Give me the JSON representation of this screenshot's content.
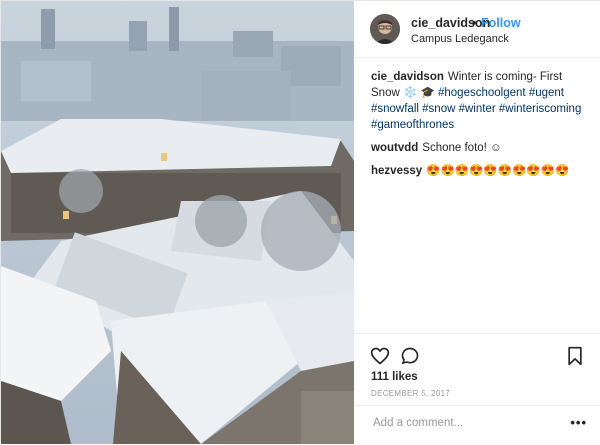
{
  "post": {
    "username": "cie_davidson",
    "separator": "•",
    "follow_label": "Follow",
    "location": "Campus Ledeganck",
    "caption_text": "Winter is coming- First Snow ❄️ 🎓",
    "caption_tags": [
      "#hogeschoolgent",
      "#ugent",
      "#snowfall",
      "#snow",
      "#winter",
      "#winteriscoming",
      "#gameofthrones"
    ],
    "comments": [
      {
        "user": "woutvdd",
        "text": "Schone foto! ☺"
      },
      {
        "user": "hezvessy",
        "text": "😍😍😍😍😍😍😍😍😍😍"
      }
    ],
    "likes": "111 likes",
    "date": "DECEMBER 5, 2017",
    "comment_placeholder": "Add a comment...",
    "more_label": "•••"
  },
  "icons": [
    "heart-icon",
    "comment-icon",
    "bookmark-icon"
  ],
  "colors": {
    "follow": "#3897f0",
    "hashtag": "#003569",
    "muted": "#999999"
  }
}
